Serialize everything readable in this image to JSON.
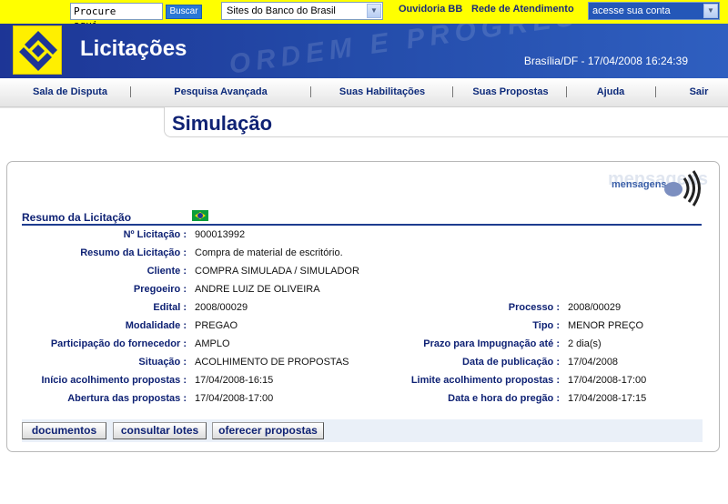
{
  "topbar": {
    "search_placeholder": "Procure aqui...",
    "search_button": "Buscar",
    "sites_select": "Sites do Banco do Brasil",
    "link_ouvidoria": "Ouvidoria BB",
    "link_rede": "Rede de Atendimento",
    "account_select": "acesse sua conta"
  },
  "header": {
    "title": "Licitações",
    "datetime": "Brasília/DF - 17/04/2008 16:24:39",
    "watermark": "ORDEM E PROGRESSO"
  },
  "nav": {
    "items": [
      "Sala de Disputa",
      "Pesquisa Avançada",
      "Suas Habilitações",
      "Suas Propostas",
      "Ajuda",
      "Sair"
    ]
  },
  "section": {
    "title": "Simulação"
  },
  "messages": {
    "label": "mensagens",
    "shadow": "mensagens"
  },
  "summary": {
    "header": "Resumo da Licitação",
    "fields": {
      "licitacao_label": "Nº Licitação :",
      "licitacao": "900013992",
      "resumo_label": "Resumo da Licitação :",
      "resumo": "Compra de material de escritório.",
      "cliente_label": "Cliente :",
      "cliente": "COMPRA SIMULADA / SIMULADOR",
      "pregoeiro_label": "Pregoeiro :",
      "pregoeiro": "ANDRE LUIZ DE OLIVEIRA",
      "edital_label": "Edital :",
      "edital": "2008/00029",
      "processo_label": "Processo :",
      "processo": "2008/00029",
      "modalidade_label": "Modalidade :",
      "modalidade": "PREGAO",
      "tipo_label": "Tipo :",
      "tipo": "MENOR PREÇO",
      "participacao_label": "Participação do fornecedor :",
      "participacao": "AMPLO",
      "prazo_label": "Prazo para Impugnação até :",
      "prazo": "2 dia(s)",
      "situacao_label": "Situação :",
      "situacao": "ACOLHIMENTO DE PROPOSTAS",
      "publicacao_label": "Data de publicação :",
      "publicacao": "17/04/2008",
      "inicio_label": "Início acolhimento propostas :",
      "inicio": "17/04/2008-16:15",
      "limite_label": "Limite acolhimento propostas :",
      "limite": "17/04/2008-17:00",
      "abertura_label": "Abertura das propostas :",
      "abertura": "17/04/2008-17:00",
      "pregao_label": "Data e hora do pregão :",
      "pregao": "17/04/2008-17:15"
    }
  },
  "actions": {
    "documentos": "documentos",
    "consultar": "consultar lotes",
    "oferecer": "oferecer propostas"
  },
  "colors": {
    "brand_yellow": "#ffff00",
    "brand_blue": "#1d3596",
    "label_blue": "#0f2274"
  }
}
